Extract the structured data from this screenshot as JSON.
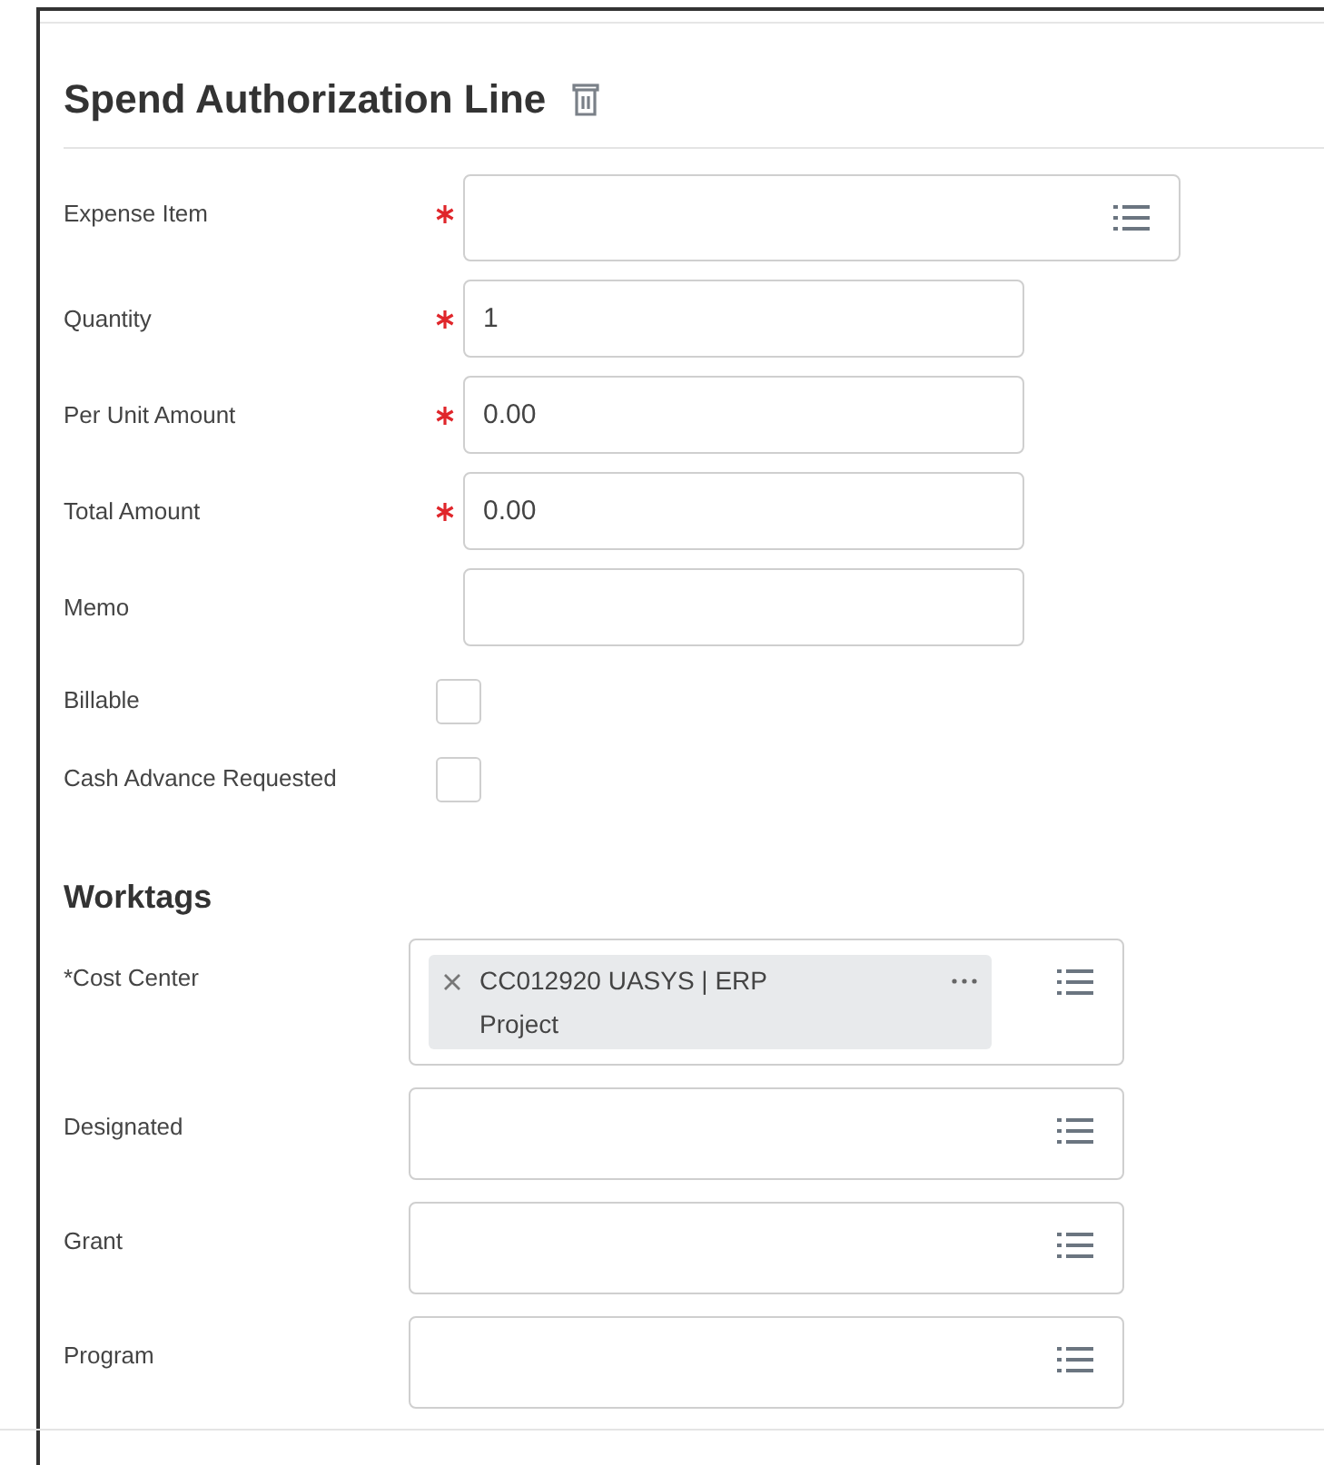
{
  "title": "Spend Authorization Line",
  "fields": [
    {
      "kind": "prompt",
      "label": "Expense Item",
      "required": true
    },
    {
      "kind": "text",
      "label": "Quantity",
      "required": true,
      "value": "1"
    },
    {
      "kind": "text",
      "label": "Per Unit Amount",
      "required": true,
      "value": "0.00"
    },
    {
      "kind": "text",
      "label": "Total Amount",
      "required": true,
      "value": "0.00"
    },
    {
      "kind": "text",
      "label": "Memo",
      "required": false
    },
    {
      "kind": "checkbox",
      "label": "Billable",
      "checked": false
    },
    {
      "kind": "checkbox",
      "label": "Cash Advance Requested",
      "checked": false
    }
  ],
  "worktags": {
    "title": "Worktags",
    "fields": [
      {
        "label": "*Cost Center",
        "tags": [
          "CC012920 UASYS | ERP Project"
        ]
      },
      {
        "label": "Designated"
      },
      {
        "label": "Grant"
      },
      {
        "label": "Program"
      }
    ]
  }
}
